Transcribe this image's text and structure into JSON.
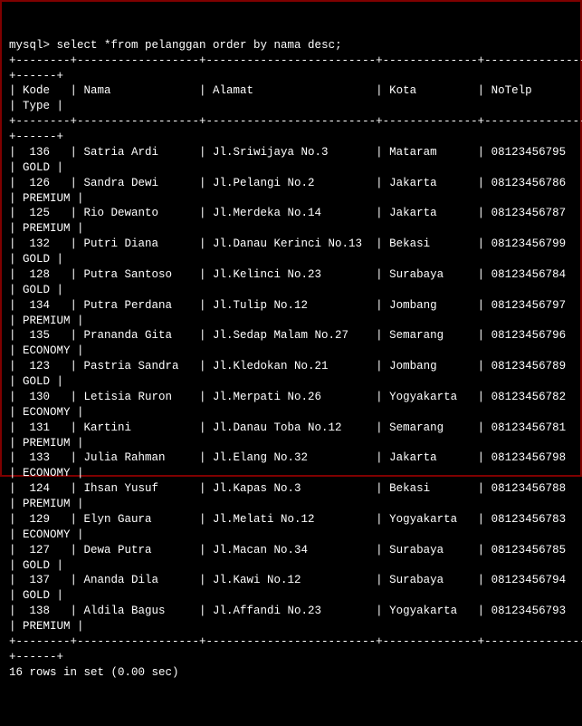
{
  "prompt": "mysql> ",
  "query": "select *from pelanggan order by nama desc;",
  "columns": [
    "Kode",
    "Nama",
    "Alamat",
    "Kota",
    "NoTelp",
    "Type"
  ],
  "rows": [
    {
      "kode": "136",
      "nama": "Satria Ardi",
      "alamat": "Jl.Sriwijaya No.3",
      "kota": "Mataram",
      "notelp": "08123456795",
      "type": "GOLD"
    },
    {
      "kode": "126",
      "nama": "Sandra Dewi",
      "alamat": "Jl.Pelangi No.2",
      "kota": "Jakarta",
      "notelp": "08123456786",
      "type": "PREMIUM"
    },
    {
      "kode": "125",
      "nama": "Rio Dewanto",
      "alamat": "Jl.Merdeka No.14",
      "kota": "Jakarta",
      "notelp": "08123456787",
      "type": "PREMIUM"
    },
    {
      "kode": "132",
      "nama": "Putri Diana",
      "alamat": "Jl.Danau Kerinci No.13",
      "kota": "Bekasi",
      "notelp": "08123456799",
      "type": "GOLD"
    },
    {
      "kode": "128",
      "nama": "Putra Santoso",
      "alamat": "Jl.Kelinci No.23",
      "kota": "Surabaya",
      "notelp": "08123456784",
      "type": "GOLD"
    },
    {
      "kode": "134",
      "nama": "Putra Perdana",
      "alamat": "Jl.Tulip No.12",
      "kota": "Jombang",
      "notelp": "08123456797",
      "type": "PREMIUM"
    },
    {
      "kode": "135",
      "nama": "Prananda Gita",
      "alamat": "Jl.Sedap Malam No.27",
      "kota": "Semarang",
      "notelp": "08123456796",
      "type": "ECONOMY"
    },
    {
      "kode": "123",
      "nama": "Pastria Sandra",
      "alamat": "Jl.Kledokan No.21",
      "kota": "Jombang",
      "notelp": "08123456789",
      "type": "GOLD"
    },
    {
      "kode": "130",
      "nama": "Letisia Ruron",
      "alamat": "Jl.Merpati No.26",
      "kota": "Yogyakarta",
      "notelp": "08123456782",
      "type": "ECONOMY"
    },
    {
      "kode": "131",
      "nama": "Kartini",
      "alamat": "Jl.Danau Toba No.12",
      "kota": "Semarang",
      "notelp": "08123456781",
      "type": "PREMIUM"
    },
    {
      "kode": "133",
      "nama": "Julia Rahman",
      "alamat": "Jl.Elang No.32",
      "kota": "Jakarta",
      "notelp": "08123456798",
      "type": "ECONOMY"
    },
    {
      "kode": "124",
      "nama": "Ihsan Yusuf",
      "alamat": "Jl.Kapas No.3",
      "kota": "Bekasi",
      "notelp": "08123456788",
      "type": "PREMIUM"
    },
    {
      "kode": "129",
      "nama": "Elyn Gaura",
      "alamat": "Jl.Melati No.12",
      "kota": "Yogyakarta",
      "notelp": "08123456783",
      "type": "ECONOMY"
    },
    {
      "kode": "127",
      "nama": "Dewa Putra",
      "alamat": "Jl.Macan No.34",
      "kota": "Surabaya",
      "notelp": "08123456785",
      "type": "GOLD"
    },
    {
      "kode": "137",
      "nama": "Ananda Dila",
      "alamat": "Jl.Kawi No.12",
      "kota": "Surabaya",
      "notelp": "08123456794",
      "type": "GOLD"
    },
    {
      "kode": "138",
      "nama": "Aldila Bagus",
      "alamat": "Jl.Affandi No.23",
      "kota": "Yogyakarta",
      "notelp": "08123456793",
      "type": "PREMIUM"
    }
  ],
  "footer": "16 rows in set (0.00 sec)",
  "widths": {
    "kode": 6,
    "nama": 16,
    "alamat": 23,
    "kota": 12,
    "notelp": 13,
    "type": 4
  },
  "total_width": 85
}
